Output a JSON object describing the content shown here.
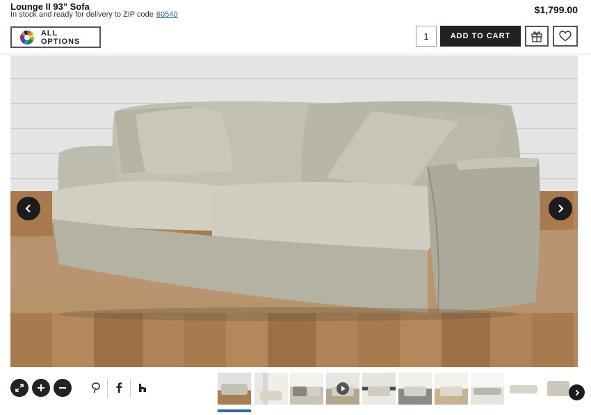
{
  "product": {
    "title": "Lounge II 93\" Sofa",
    "stock_text": "In stock and ready for delivery to ZIP code",
    "zip_code": "60540",
    "price": "$1,799.00"
  },
  "toolbar": {
    "all_options_label": "ALL OPTIONS",
    "quantity": "1",
    "add_to_cart_label": "ADD TO CART"
  },
  "gallery": {
    "prev_icon": "chevron-left-icon",
    "next_icon": "chevron-right-icon",
    "active_thumbnail": 1,
    "thumbnail_count": 10,
    "video_thumbnail": 4
  },
  "tools": {
    "icons": [
      "expand-icon",
      "zoom-in-icon",
      "zoom-out-icon",
      "pinterest-icon",
      "facebook-icon",
      "houzz-icon"
    ]
  },
  "colors": {
    "primary_button": "#222222",
    "link": "#2a6aa8",
    "active_indicator": "#2a6aa8"
  }
}
